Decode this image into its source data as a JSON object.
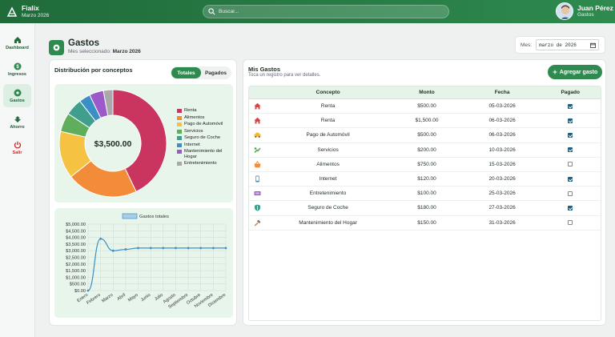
{
  "app": {
    "name": "Fialix",
    "subtitle": "Marzo 2026"
  },
  "search": {
    "placeholder": "Buscar..."
  },
  "user": {
    "name": "Juan Pérez",
    "role": "Gastos"
  },
  "sidebar": {
    "items": [
      {
        "label": "Dashboard",
        "icon": "home-icon"
      },
      {
        "label": "Ingresos",
        "icon": "dollar-icon"
      },
      {
        "label": "Gastos",
        "icon": "gastos-icon",
        "active": true
      },
      {
        "label": "Ahorro",
        "icon": "piggy-icon"
      },
      {
        "label": "Salir",
        "icon": "power-icon"
      }
    ]
  },
  "page": {
    "title": "Gastos",
    "subtitle_prefix": "Mes seleccionado: ",
    "subtitle_month": "Marzo 2026",
    "month_label": "Mes:",
    "month_value": "marzo de 2026"
  },
  "distribution": {
    "title": "Distribución por conceptos",
    "toggle_totales": "Totales",
    "toggle_pagados": "Pagados",
    "total_label": "$3,500.00"
  },
  "colors": {
    "primary": "#2e8a4e",
    "line": "#3a8fc7"
  },
  "chart_data": [
    {
      "type": "pie",
      "center_label": "$3,500.00",
      "categories": [
        "Renta",
        "Alimentos",
        "Pago de Automóvil",
        "Servicios",
        "Seguro de Coche",
        "Internet",
        "Mantenimiento del Hogar",
        "Entretenimiento"
      ],
      "values": [
        1500,
        750,
        500,
        200,
        180,
        120,
        150,
        100
      ],
      "colors": [
        "#c9355e",
        "#f28c38",
        "#f5c242",
        "#5fae5c",
        "#3f9e8c",
        "#3a8fc7",
        "#9b59c9",
        "#a9a9a9"
      ],
      "legend_labels": [
        "Renta",
        "Alimentos",
        "Pago de Automóvil",
        "Servicios",
        "Seguro de Coche",
        "Internet",
        "Mantenimiento del Hogar",
        "Entretenimiento"
      ]
    },
    {
      "type": "line",
      "series": [
        {
          "name": "Gastos totales",
          "values": [
            0,
            3900,
            3000,
            3100,
            3200,
            3200,
            3200,
            3200,
            3200,
            3200,
            3200,
            3200
          ]
        }
      ],
      "categories": [
        "Enero",
        "Febrero",
        "Marzo",
        "Abril",
        "Mayo",
        "Junio",
        "Julio",
        "Agosto",
        "Septiembre",
        "Octubre",
        "Noviembre",
        "Diciembre"
      ],
      "ylim": [
        0,
        5000
      ],
      "yticks": [
        "$0.00",
        "$500.00",
        "$1,000.00",
        "$1,500.00",
        "$2,000.00",
        "$2,500.00",
        "$3,000.00",
        "$3,500.00",
        "$4,000.00",
        "$4,500.00",
        "$5,000.00"
      ],
      "grid": true,
      "legend_position": "top"
    }
  ],
  "gastos": {
    "title": "Mis Gastos",
    "subtitle": "Toca un registro para ver detalles.",
    "add_label": "Agregar gasto",
    "columns": [
      "Concepto",
      "Monto",
      "Fecha",
      "Pagado"
    ],
    "rows": [
      {
        "icon": "house-icon",
        "icon_color": "#d84343",
        "concepto": "Renta",
        "monto": "$500.00",
        "fecha": "05-03-2026",
        "pagado": true
      },
      {
        "icon": "house-icon",
        "icon_color": "#d84343",
        "concepto": "Renta",
        "monto": "$1,500.00",
        "fecha": "06-03-2026",
        "pagado": true
      },
      {
        "icon": "car-icon",
        "icon_color": "#f2b630",
        "concepto": "Pago de Automóvil",
        "monto": "$500.00",
        "fecha": "06-03-2026",
        "pagado": true
      },
      {
        "icon": "utilities-icon",
        "icon_color": "#5fae5c",
        "concepto": "Servicios",
        "monto": "$200.00",
        "fecha": "10-03-2026",
        "pagado": true
      },
      {
        "icon": "basket-icon",
        "icon_color": "#f28c38",
        "concepto": "Alimentos",
        "monto": "$750.00",
        "fecha": "15-03-2026",
        "pagado": false
      },
      {
        "icon": "phone-icon",
        "icon_color": "#3a8fc7",
        "concepto": "Internet",
        "monto": "$120.00",
        "fecha": "20-03-2026",
        "pagado": true
      },
      {
        "icon": "ticket-icon",
        "icon_color": "#9b59c9",
        "concepto": "Entretenimiento",
        "monto": "$100.00",
        "fecha": "25-03-2026",
        "pagado": false
      },
      {
        "icon": "shield-icon",
        "icon_color": "#3f9e8c",
        "concepto": "Seguro de Coche",
        "monto": "$180.00",
        "fecha": "27-03-2026",
        "pagado": true
      },
      {
        "icon": "hammer-icon",
        "icon_color": "#c98432",
        "concepto": "Mantenimiento del Hogar",
        "monto": "$150.00",
        "fecha": "31-03-2026",
        "pagado": false
      }
    ]
  }
}
